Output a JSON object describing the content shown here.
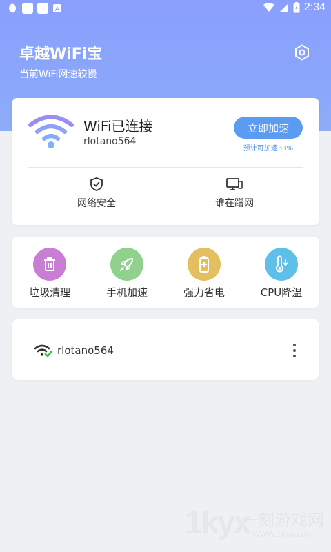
{
  "status_bar": {
    "time": "2:34"
  },
  "header": {
    "title": "卓越WiFi宝",
    "subtitle": "当前WiFi网速较慢"
  },
  "connection_card": {
    "status": "WiFi已连接",
    "ssid": "rlotano564",
    "speed_button": "立即加速",
    "speed_note": "预计可加速33%",
    "features": [
      {
        "label": "网络安全",
        "icon": "shield-check-icon"
      },
      {
        "label": "谁在蹭网",
        "icon": "devices-icon"
      }
    ]
  },
  "tools": [
    {
      "label": "垃圾清理",
      "icon": "trash-icon",
      "color": "#c77ed3"
    },
    {
      "label": "手机加速",
      "icon": "rocket-icon",
      "color": "#8fd18d"
    },
    {
      "label": "强力省电",
      "icon": "battery-icon",
      "color": "#e3bf5f"
    },
    {
      "label": "CPU降温",
      "icon": "thermometer-icon",
      "color": "#5ec0e8"
    }
  ],
  "network_list": [
    {
      "ssid": "rlotano564",
      "icon": "wifi-connected-icon"
    }
  ],
  "watermark": {
    "logo": "1kyx",
    "text": "一刻游戏网",
    "url": "WWW.1kyx.com"
  }
}
